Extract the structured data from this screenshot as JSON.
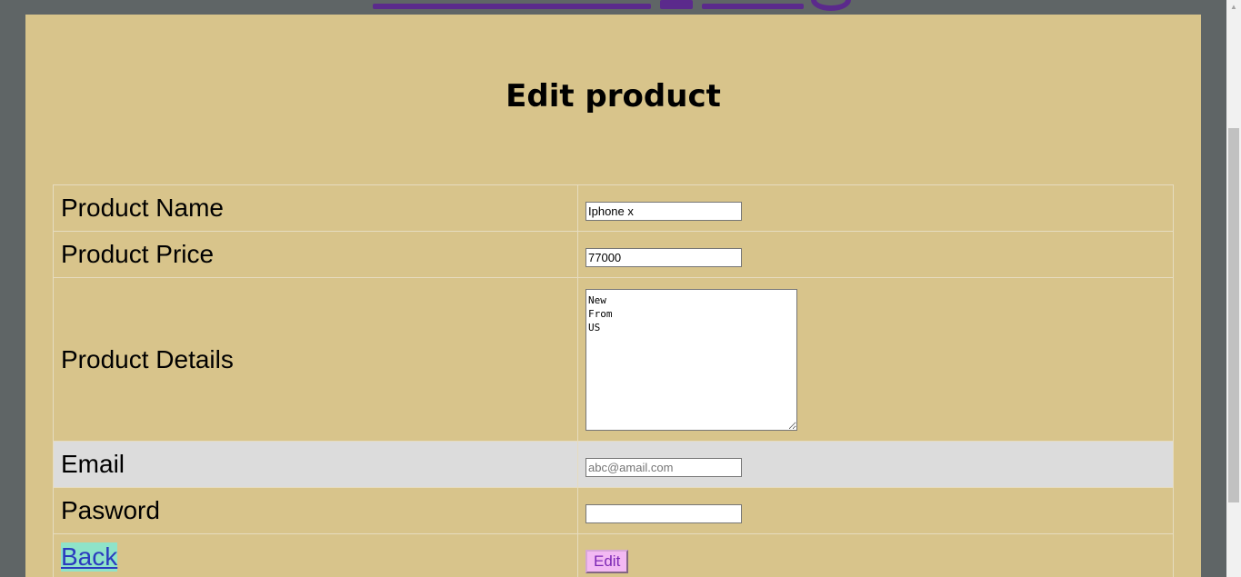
{
  "page": {
    "title": "Edit product"
  },
  "form": {
    "product_name": {
      "label": "Product Name",
      "value": "Iphone x"
    },
    "product_price": {
      "label": "Product Price",
      "value": "77000"
    },
    "product_details": {
      "label": "Product Details",
      "value": "New\nFrom\nUS"
    },
    "email": {
      "label": "Email",
      "value": "",
      "placeholder": "abc@amail.com"
    },
    "password": {
      "label": "Pasword",
      "value": ""
    },
    "back_label": "Back",
    "edit_label": "Edit"
  },
  "icons": {
    "scroll_up": "scroll-up-arrow-icon"
  },
  "colors": {
    "page_background": "#d8c48b",
    "outer_background": "#5f6566",
    "email_row_background": "#dcdcdc",
    "back_link_background": "#8fe3c9",
    "back_link_text": "#2b3bbf",
    "edit_button_background": "#f3b9f3",
    "edit_button_text": "#7d28b5",
    "banner_accent": "#5b2a8c"
  }
}
